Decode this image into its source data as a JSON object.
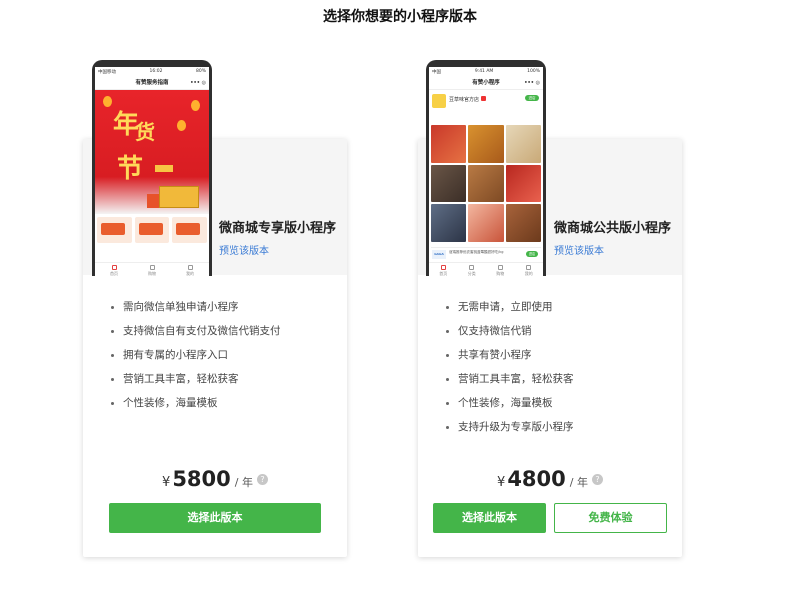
{
  "page": {
    "title": "选择你想要的小程序版本"
  },
  "plans": [
    {
      "name": "微商城专享版小程序",
      "preview_link": "预览该版本",
      "features": [
        "需向微信单独申请小程序",
        "支持微信自有支付及微信代销支付",
        "拥有专属的小程序入口",
        "营销工具丰富，轻松获客",
        "个性装修，海量模板"
      ],
      "currency": "¥",
      "price": "5800",
      "unit": "/ 年",
      "help": "?",
      "primary_button": "选择此版本",
      "phone": {
        "status_left": "中国移动",
        "status_time": "16:02",
        "status_right": "80%",
        "nav_title": "有赞服务指南",
        "nav_ctrl": "••• ◎",
        "banner_big_1": "年",
        "banner_big_2": "货",
        "banner_big_3": "节",
        "tabs": [
          "首页",
          "购物",
          "我的"
        ]
      }
    },
    {
      "name": "微商城公共版小程序",
      "preview_link": "预览该版本",
      "features": [
        "无需申请，立即使用",
        "仅支持微信代销",
        "共享有赞小程序",
        "营销工具丰富，轻松获客",
        "个性装修，海量模板",
        "支持升级为专享版小程序"
      ],
      "currency": "¥",
      "price": "4800",
      "unit": "/ 年",
      "help": "?",
      "primary_button": "选择此版本",
      "secondary_button": "免费体验",
      "phone": {
        "status_left": "中国",
        "status_time": "9:41 AM",
        "status_right": "100%",
        "nav_title": "有赞小程序",
        "nav_ctrl": "••• ◎",
        "shop_name": "豆草味官方店",
        "shop_btn": "进店",
        "ad_logo": "GAGA",
        "ad_text": "谊瑞推荐优农蜜桃蓝莓酸甜好吃/kg",
        "ad_btn": "进店",
        "tabs": [
          "首页",
          "分类",
          "购物",
          "我的"
        ]
      }
    }
  ],
  "colors": {
    "accent": "#44b549",
    "link": "#3a7bd5"
  }
}
